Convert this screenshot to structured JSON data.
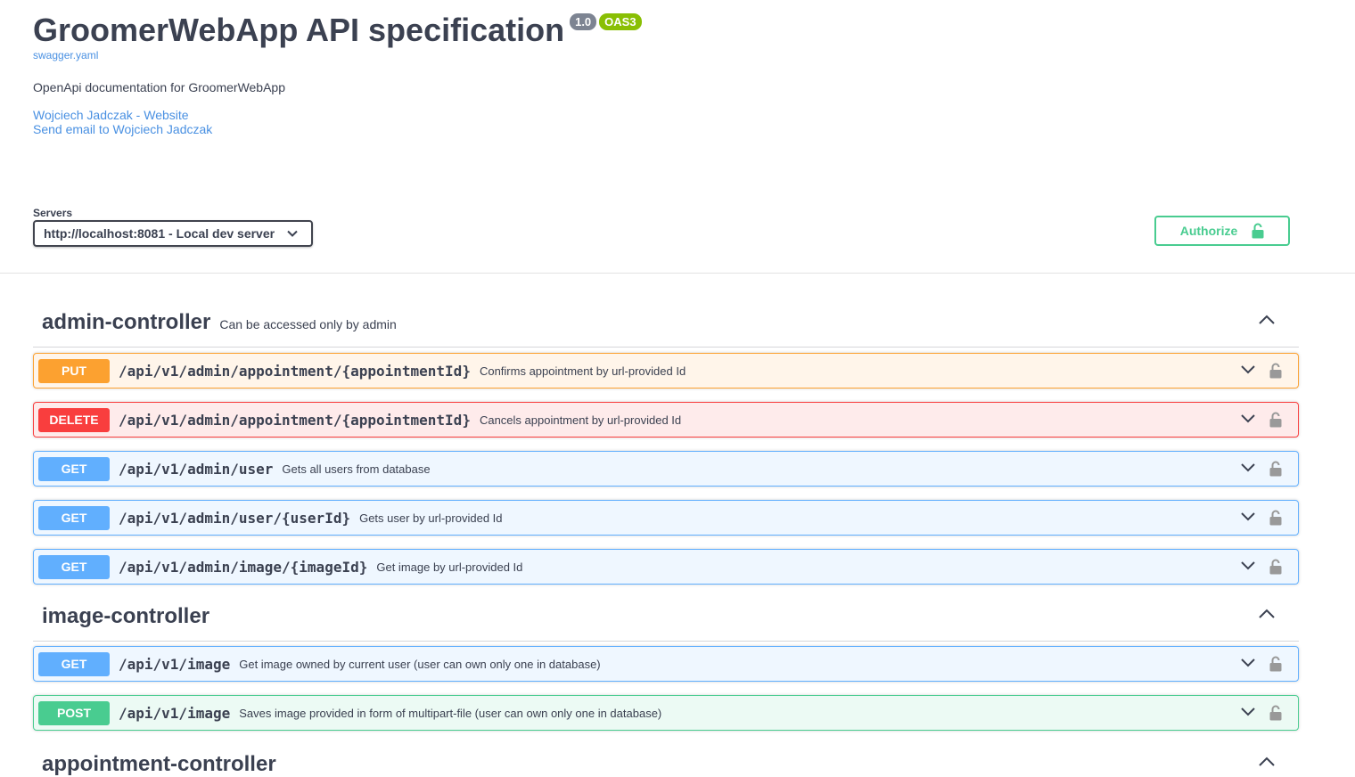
{
  "info": {
    "title": "GroomerWebApp API specification",
    "version": "1.0",
    "oas": "OAS3",
    "spec_link": "swagger.yaml",
    "description": "OpenApi documentation for GroomerWebApp",
    "contact_website": "Wojciech Jadczak - Website",
    "contact_email": "Send email to Wojciech Jadczak"
  },
  "servers": {
    "label": "Servers",
    "selected": "http://localhost:8081 - Local dev server"
  },
  "authorize": {
    "label": "Authorize"
  },
  "tags": [
    {
      "name": "admin-controller",
      "description": "Can be accessed only by admin",
      "operations": [
        {
          "method": "PUT",
          "path": "/api/v1/admin/appointment/{appointmentId}",
          "summary": "Confirms appointment by url-provided Id"
        },
        {
          "method": "DELETE",
          "path": "/api/v1/admin/appointment/{appointmentId}",
          "summary": "Cancels appointment by url-provided Id"
        },
        {
          "method": "GET",
          "path": "/api/v1/admin/user",
          "summary": "Gets all users from database"
        },
        {
          "method": "GET",
          "path": "/api/v1/admin/user/{userId}",
          "summary": "Gets user by url-provided Id"
        },
        {
          "method": "GET",
          "path": "/api/v1/admin/image/{imageId}",
          "summary": "Get image by url-provided Id"
        }
      ]
    },
    {
      "name": "image-controller",
      "description": "",
      "operations": [
        {
          "method": "GET",
          "path": "/api/v1/image",
          "summary": "Get image owned by current user (user can own only one in database)"
        },
        {
          "method": "POST",
          "path": "/api/v1/image",
          "summary": "Saves image provided in form of multipart-file (user can own only one in database)"
        }
      ]
    },
    {
      "name": "appointment-controller",
      "description": "",
      "operations": []
    }
  ],
  "colors": {
    "put": "#fca130",
    "delete": "#f93e3e",
    "get": "#61affe",
    "post": "#49cc90",
    "link": "#4990e2"
  },
  "icons": {
    "expand": "chevron-down-icon",
    "collapse": "chevron-up-icon",
    "lock": "lock-icon"
  }
}
